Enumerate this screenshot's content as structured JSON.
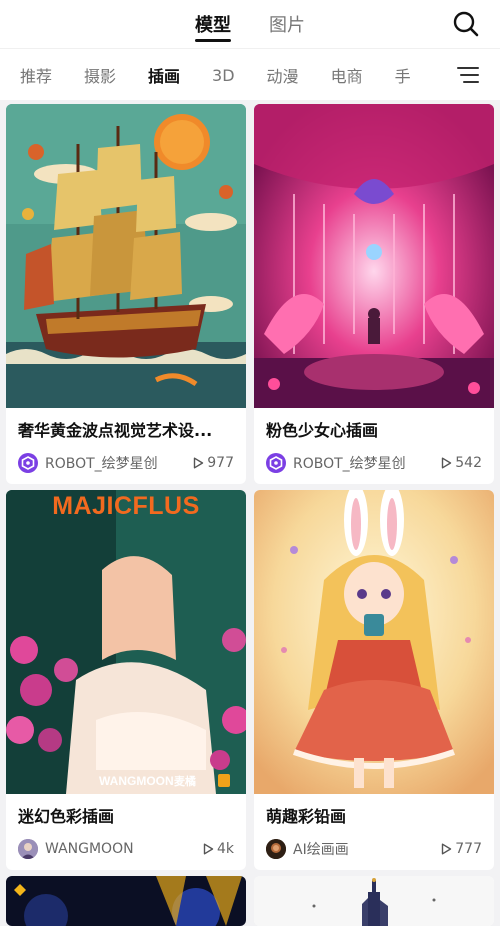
{
  "top_tabs": [
    {
      "label": "模型",
      "active": true
    },
    {
      "label": "图片",
      "active": false
    }
  ],
  "categories": [
    {
      "label": "推荐",
      "active": false
    },
    {
      "label": "摄影",
      "active": false
    },
    {
      "label": "插画",
      "active": true
    },
    {
      "label": "3D",
      "active": false
    },
    {
      "label": "动漫",
      "active": false
    },
    {
      "label": "电商",
      "active": false
    },
    {
      "label": "手",
      "active": false
    }
  ],
  "icons": {
    "search": "search-icon",
    "filter": "filter-icon",
    "play": "play-icon"
  },
  "cards": [
    {
      "title": "奢华黄金波点视觉艺术设...",
      "author": "ROBOT_绘梦星创",
      "views": "977",
      "avatar": "purple-hexagon"
    },
    {
      "title": "粉色少女心插画",
      "author": "ROBOT_绘梦星创",
      "views": "542",
      "avatar": "purple-hexagon"
    },
    {
      "title": "迷幻色彩插画",
      "author": "WANGMOON",
      "views": "4k",
      "avatar": "user-photo",
      "image_text": "MAJICFLUS",
      "watermark_text": "WANGMOON",
      "watermark_brand": "麦橘"
    },
    {
      "title": "萌趣彩铅画",
      "author": "AI绘画画",
      "views": "777",
      "avatar": "user-photo"
    }
  ],
  "colors": {
    "accent_purple": "#7b3fe4",
    "text_primary": "#111111",
    "text_secondary": "#666666"
  }
}
